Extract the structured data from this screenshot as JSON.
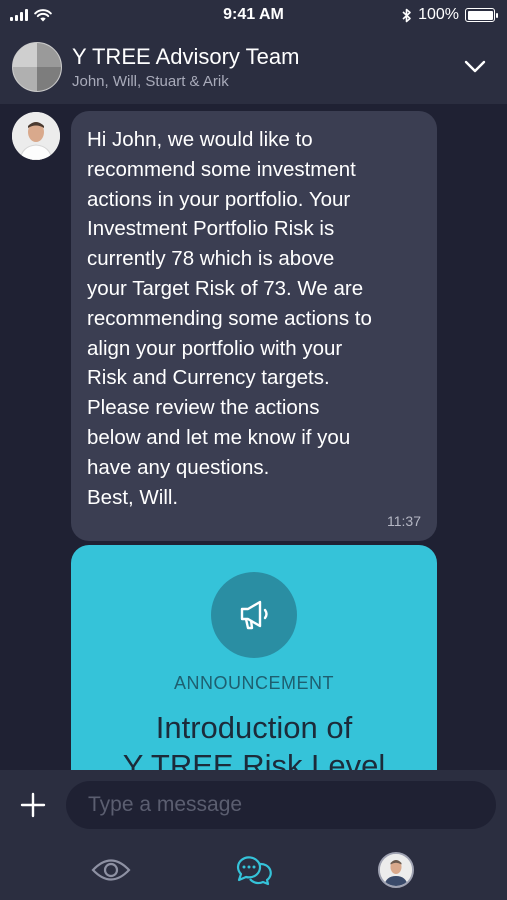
{
  "status_bar": {
    "time": "9:41 AM",
    "battery_text": "100%",
    "battery_level": 1.0
  },
  "header": {
    "title": "Y TREE Advisory Team",
    "subtitle": "John, Will, Stuart & Arik"
  },
  "messages": [
    {
      "text": "Hi John, we would like to\nrecommend some investment\nactions in your portfolio. Your\nInvestment Portfolio Risk is\ncurrently 78 which is above\nyour Target Risk of 73. We are\nrecommending some actions to\nalign your portfolio with your\nRisk and Currency targets.\nPlease review the actions\nbelow and let me know if you\nhave any questions.\nBest, Will.",
      "time": "11:37"
    }
  ],
  "card": {
    "icon": "megaphone-icon",
    "label": "ANNOUNCEMENT",
    "title": "Introduction of\nY TREE Risk Level"
  },
  "composer": {
    "placeholder": "Type a message"
  },
  "tabbar": {
    "items": [
      "eye-icon",
      "chat-icon",
      "profile-avatar"
    ],
    "active": "chat-icon"
  },
  "colors": {
    "background": "#1f2133",
    "panel": "#2b2e40",
    "bubble": "#3b3e52",
    "accent": "#35c3d9"
  }
}
